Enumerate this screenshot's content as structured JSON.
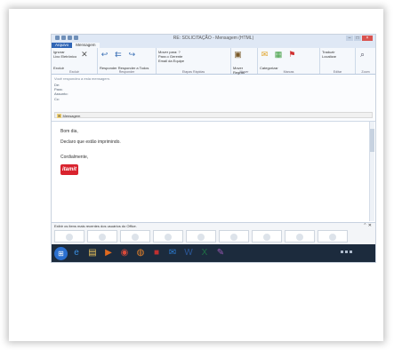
{
  "window": {
    "title": "RE: SOLICITAÇÃO - Mensagem (HTML)"
  },
  "tabs": [
    "Arquivo",
    "Mensagem"
  ],
  "ribbon": {
    "groups": [
      {
        "label": "Excluir",
        "buttons": [
          "Ignorar",
          "Lixo Eletrônico",
          "Excluir"
        ]
      },
      {
        "label": "Responder",
        "buttons": [
          "Responder",
          "Responder a Todos",
          "Encaminhar"
        ]
      },
      {
        "label": "Etapas Rápidas",
        "buttons": [
          "Mover para: ?",
          "Para o Gerente",
          "Email da Equipe"
        ]
      },
      {
        "label": "Mover",
        "buttons": [
          "Mover",
          "Regras"
        ]
      },
      {
        "label": "Marcas",
        "buttons": [
          "Marcar como Não Lida",
          "Categorizar",
          "Acompanhamento"
        ]
      },
      {
        "label": "Editar",
        "buttons": [
          "Traduzir",
          "Localizar"
        ]
      },
      {
        "label": "Zoom",
        "buttons": [
          "Zoom"
        ]
      }
    ]
  },
  "header": {
    "info": "Você respondeu a esta mensagem.",
    "from_label": "De:",
    "from_value": "",
    "to_label": "Para:",
    "to_value": "",
    "subject_label": "Assunto:",
    "subject_value": "",
    "cc_label": "Cc:",
    "cc_value": "",
    "sent": "",
    "attachment_message": "Mensagem",
    "attachment_file": ""
  },
  "body": {
    "greeting": "Bom dia,",
    "text": "Declaro que estão imprimindo.",
    "signoff": "Cordialmente,",
    "logo_text": "itamit",
    "signature": [
      "",
      "",
      "",
      "",
      "",
      "",
      ""
    ],
    "links": [
      "",
      "",
      ""
    ]
  },
  "people_pane": {
    "text": "Exibir os itens mais recentes dos usuários do Office."
  },
  "taskbar": {
    "icons": [
      {
        "name": "start-icon",
        "glyph": "⊞",
        "color": "#2a6fcf"
      },
      {
        "name": "ie-icon",
        "glyph": "e",
        "color": "#3b8fe0"
      },
      {
        "name": "explorer-icon",
        "glyph": "▤",
        "color": "#e8c15a"
      },
      {
        "name": "media-icon",
        "glyph": "▶",
        "color": "#e06a1f"
      },
      {
        "name": "chrome-icon",
        "glyph": "◉",
        "color": "#d94a3a"
      },
      {
        "name": "firefox-icon",
        "glyph": "◍",
        "color": "#e8832a"
      },
      {
        "name": "app-icon",
        "glyph": "■",
        "color": "#c03030"
      },
      {
        "name": "outlook-icon",
        "glyph": "✉",
        "color": "#2b7cd3"
      },
      {
        "name": "word-icon",
        "glyph": "W",
        "color": "#2b5797"
      },
      {
        "name": "excel-icon",
        "glyph": "X",
        "color": "#1e7145"
      },
      {
        "name": "paint-icon",
        "glyph": "✎",
        "color": "#9b59b6"
      }
    ],
    "time": "",
    "date": ""
  }
}
